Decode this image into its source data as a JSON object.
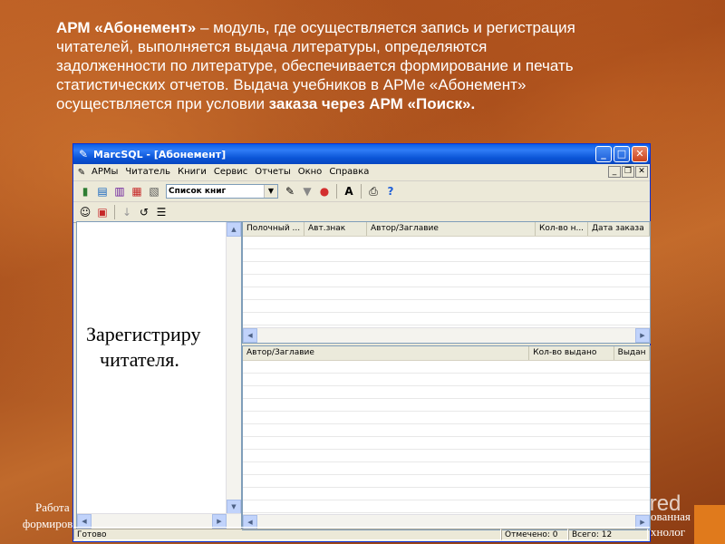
{
  "slide": {
    "line1_bold": "АРМ «Абонемент»",
    "line1_rest": " – модуль, где осуществляется запись и регистрация",
    "line2": "читателей, выполняется выдача литературы, определяются",
    "line3": "задолженности по литературе, обеспечивается формирование и печать",
    "line4": "статистических отчетов. Выдача учебников в АРМе «Абонемент»",
    "line5_plain": "осуществляется при условии ",
    "line5_bold": " заказа через АРМ «Поиск».",
    "footer_left_1": "Работа в",
    "footer_left_2": "формирова",
    "footer_right_1": "ованная",
    "footer_right_2": "хнолог",
    "watermark": "MyShared"
  },
  "window": {
    "title": "MarcSQL - [Абонемент]",
    "menu": [
      "АРМы",
      "Читатель",
      "Книги",
      "Сервис",
      "Отчеты",
      "Окно",
      "Справка"
    ],
    "combo_value": "Список книг",
    "left_pane_text_1": "Зарегистриру",
    "left_pane_text_2": "читателя.",
    "top_grid_columns": [
      "Полочный ...",
      "Авт.знак",
      "Автор/Заглавие",
      "Кол-во н...",
      "Дата заказа"
    ],
    "bottom_grid_columns": [
      "Автор/Заглавие",
      "Кол-во выдано",
      "Выдан"
    ],
    "status": {
      "ready": "Готово",
      "marked": "Отмечено: 0",
      "total": "Всего: 12"
    }
  },
  "colors": {
    "titlebar": "#0a54d6",
    "window_bg": "#ece9d8",
    "slide_bg": "#a8491a"
  }
}
